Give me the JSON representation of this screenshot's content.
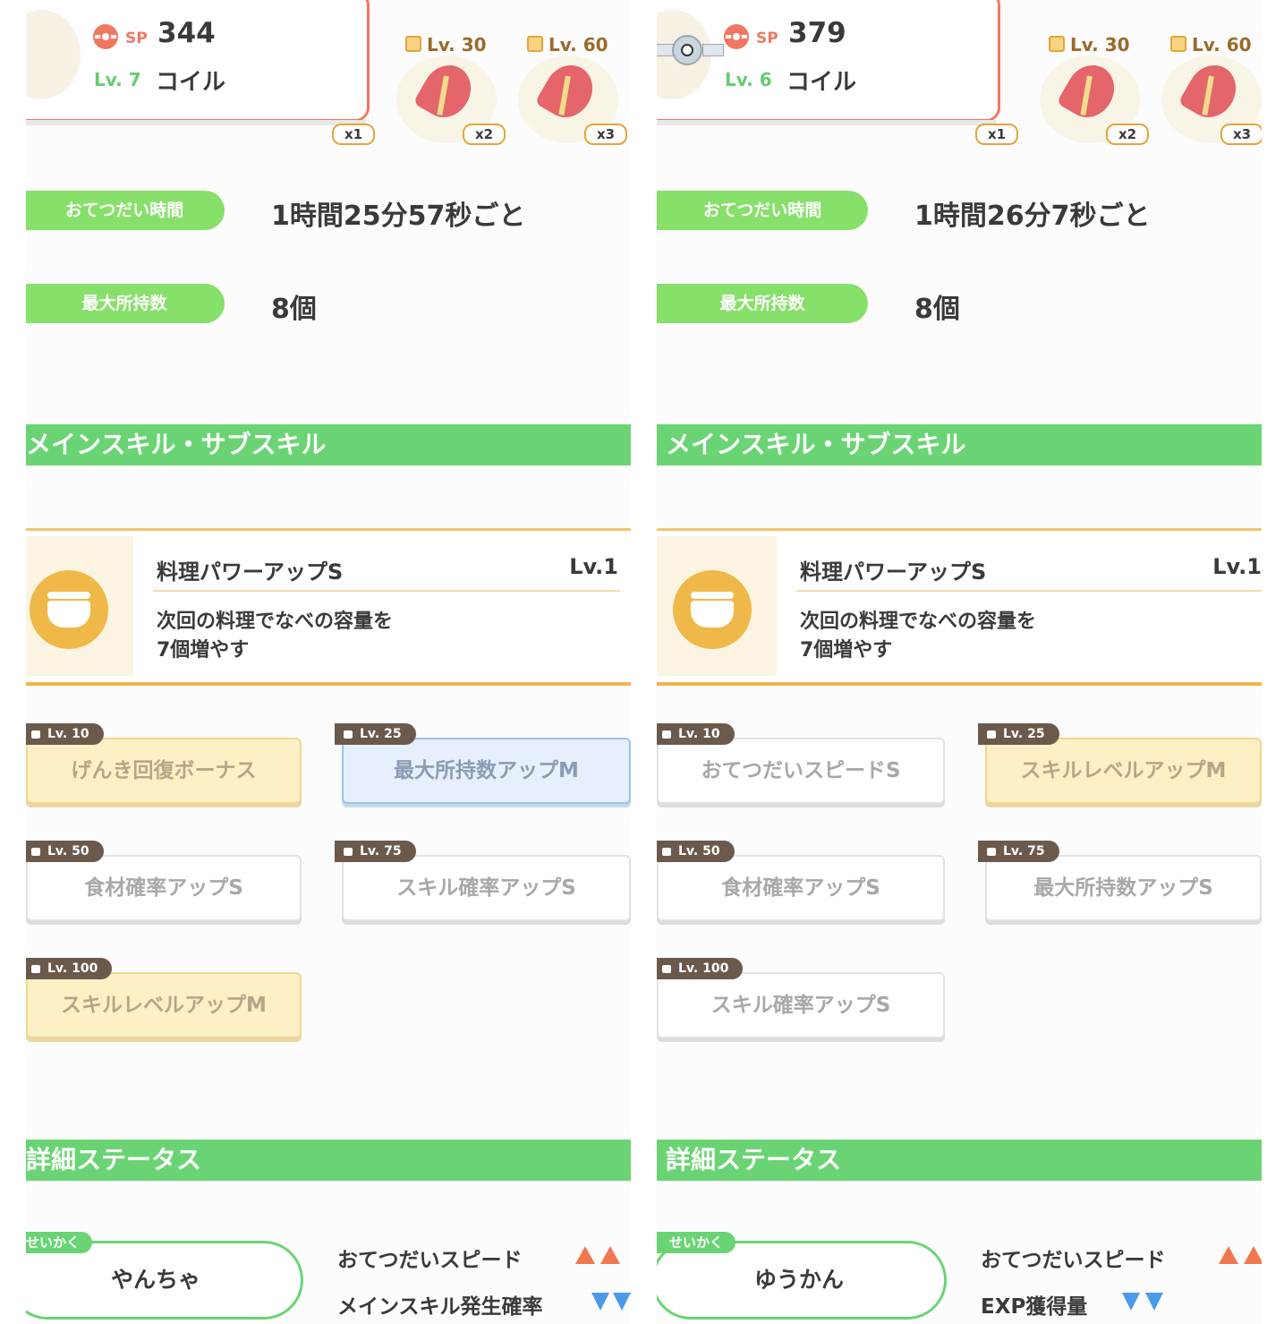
{
  "left": {
    "sp_label": "SP",
    "sp_value": "344",
    "level": "Lv. 7",
    "name": "コイル",
    "ingredient_first_count": "x1",
    "ingredients": [
      {
        "unlock": "Lv. 30",
        "count": "x2"
      },
      {
        "unlock": "Lv. 60",
        "count": "x3"
      }
    ],
    "help_time_label": "おてつだい時間",
    "help_time_value": "1時間25分57秒ごと",
    "max_carry_label": "最大所持数",
    "max_carry_value": "8個",
    "skills_header": "メインスキル・サブスキル",
    "main_skill": {
      "name": "料理パワーアップS",
      "level": "Lv.1",
      "desc_line1": "次回の料理でなべの容量を",
      "desc_line2": "7個増やす"
    },
    "sub_skills": [
      {
        "unlock": "Lv. 10",
        "name": "げんき回復ボーナス",
        "style": "gold"
      },
      {
        "unlock": "Lv. 25",
        "name": "最大所持数アップM",
        "style": "blue"
      },
      {
        "unlock": "Lv. 50",
        "name": "食材確率アップS",
        "style": "white"
      },
      {
        "unlock": "Lv. 75",
        "name": "スキル確率アップS",
        "style": "white"
      },
      {
        "unlock": "Lv. 100",
        "name": "スキルレベルアップM",
        "style": "gold"
      }
    ],
    "status_header": "詳細ステータス",
    "nature_label": "せいかく",
    "nature": "やんちゃ",
    "stat_up": "おてつだいスピード",
    "stat_down": "メインスキル発生確率",
    "colors": {
      "up": "#f07850",
      "down": "#4a9ae8"
    }
  },
  "right": {
    "sp_label": "SP",
    "sp_value": "379",
    "level": "Lv. 6",
    "name": "コイル",
    "ingredient_first_count": "x1",
    "ingredients": [
      {
        "unlock": "Lv. 30",
        "count": "x2"
      },
      {
        "unlock": "Lv. 60",
        "count": "x3"
      }
    ],
    "help_time_label": "おてつだい時間",
    "help_time_value": "1時間26分7秒ごと",
    "max_carry_label": "最大所持数",
    "max_carry_value": "8個",
    "skills_header": "メインスキル・サブスキル",
    "main_skill": {
      "name": "料理パワーアップS",
      "level": "Lv.1",
      "desc_line1": "次回の料理でなべの容量を",
      "desc_line2": "7個増やす"
    },
    "sub_skills": [
      {
        "unlock": "Lv. 10",
        "name": "おてつだいスピードS",
        "style": "white"
      },
      {
        "unlock": "Lv. 25",
        "name": "スキルレベルアップM",
        "style": "gold"
      },
      {
        "unlock": "Lv. 50",
        "name": "食材確率アップS",
        "style": "white"
      },
      {
        "unlock": "Lv. 75",
        "name": "最大所持数アップS",
        "style": "white"
      },
      {
        "unlock": "Lv. 100",
        "name": "スキル確率アップS",
        "style": "white"
      }
    ],
    "status_header": "詳細ステータス",
    "nature_label": "せいかく",
    "nature": "ゆうかん",
    "stat_up": "おてつだいスピード",
    "stat_down": "EXP獲得量",
    "colors": {
      "up": "#f07850",
      "down": "#4a9ae8"
    }
  }
}
